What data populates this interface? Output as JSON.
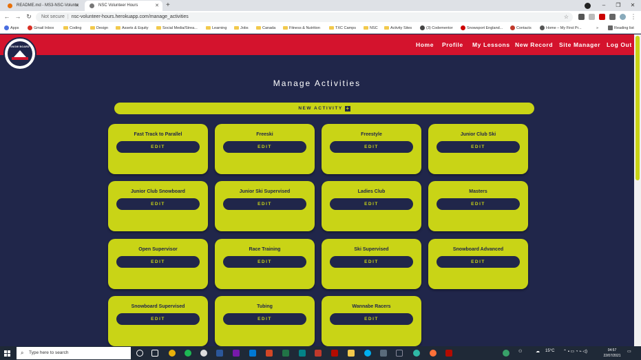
{
  "browser": {
    "tabs": [
      {
        "title": "README.md - MS3-NSC-Volunte",
        "icon": "github-favicon"
      },
      {
        "title": "NSC Volunteer Hours",
        "icon": "site-favicon"
      }
    ],
    "new_tab": "+",
    "security": "Not secure",
    "url": "nsc-volunteer-hours.herokuapp.com/manage_activities",
    "reading_list": "Reading list",
    "bookmarks": [
      "Apps",
      "Gmail Inbox",
      "Coding",
      "Design",
      "Assets & Equity",
      "Social Media/Strea...",
      "Learning",
      "Jobs",
      "Canada",
      "Fitness & Nutrition",
      "TXC Camps",
      "NSC",
      "Activity Sites",
      "(3) Codementor",
      "Snowsport England...",
      "Contacts",
      "Home – My First Pr..."
    ]
  },
  "site": {
    "logo_text": "SNOW BOARD",
    "nav": [
      "Home",
      "Profile",
      "My Lessons",
      "New Record",
      "Site Manager",
      "Log Out"
    ],
    "heading": "Manage Activities",
    "new_activity": "NEW ACTIVITY",
    "edit_label": "EDIT",
    "activities": [
      "Fast Track to Parallel",
      "Freeski",
      "Freestyle",
      "Junior Club Ski",
      "Junior Club Snowboard",
      "Junior Ski Supervised",
      "Ladies Club",
      "Masters",
      "Open Supervisor",
      "Race Training",
      "Ski Supervised",
      "Snowboard Advanced",
      "Snowboard Supervised",
      "Tubing",
      "Wannabe Racers"
    ]
  },
  "taskbar": {
    "search_placeholder": "Type here to search",
    "weather": "15°C",
    "time": "04:57",
    "date": "22/07/2021"
  },
  "colors": {
    "navy": "#20264a",
    "lime": "#c9d416",
    "red": "#d4132d"
  }
}
